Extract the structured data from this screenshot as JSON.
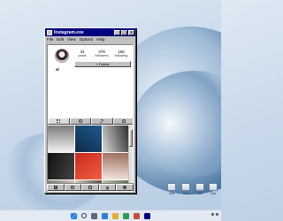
{
  "window": {
    "title": "Instagram.exe",
    "menus": [
      "File",
      "Edit",
      "View",
      "Options",
      "Help"
    ],
    "minimize_glyph": "_",
    "maximize_glyph": "□",
    "close_glyph": "x"
  },
  "profile": {
    "stats": [
      {
        "number": "34",
        "label": "posts"
      },
      {
        "number": "378",
        "label": "followers"
      },
      {
        "number": "166",
        "label": "following"
      }
    ],
    "follow_label": "+ Follow",
    "username": "al"
  },
  "tabs": [
    {
      "icon": "grid-icon",
      "active": true
    },
    {
      "icon": "reels-icon",
      "active": false
    },
    {
      "icon": "gear-icon",
      "active": false
    },
    {
      "icon": "tagged-icon",
      "active": false
    }
  ],
  "posts": [
    {
      "color_a": "#f2f2f2",
      "color_b": "#7a7a7a"
    },
    {
      "color_a": "#0f2a4a",
      "color_b": "#1e5a8a"
    },
    {
      "color_a": "#d8d8d8",
      "color_b": "#2a2a2a"
    },
    {
      "color_a": "#111111",
      "color_b": "#444444"
    },
    {
      "color_a": "#c8281e",
      "color_b": "#f06040"
    },
    {
      "color_a": "#f3e7e0",
      "color_b": "#9a6b5a"
    },
    {
      "color_a": "#2a2a2a",
      "color_b": "#d4c9bd"
    },
    {
      "color_a": "#e9e1d8",
      "color_b": "#5a4a3a"
    },
    {
      "color_a": "#b9c6a8",
      "color_b": "#3a4a2a"
    }
  ],
  "bottom_nav": [
    "home-icon",
    "search-icon",
    "reels-icon",
    "heart-icon",
    "profile-icon"
  ],
  "desktop_icons": [
    {
      "label": "Inst"
    },
    {
      "label": "Inst"
    },
    {
      "label": "Inst"
    },
    {
      "label": "Inst"
    }
  ]
}
